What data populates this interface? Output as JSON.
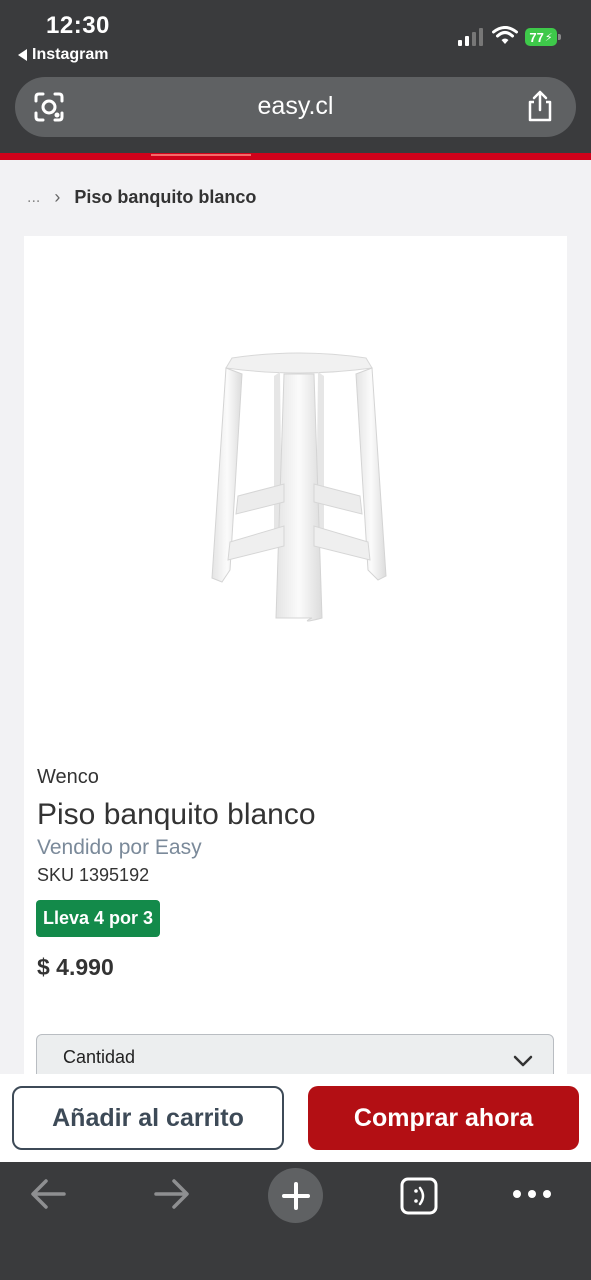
{
  "status_bar": {
    "time": "12:30",
    "back_app": "Instagram",
    "battery": "77"
  },
  "browser": {
    "url": "easy.cl"
  },
  "breadcrumb": {
    "ellipsis": "...",
    "current": "Piso banquito blanco"
  },
  "product": {
    "brand": "Wenco",
    "title": "Piso banquito blanco",
    "seller": "Vendido por Easy",
    "sku": "SKU 1395192",
    "promo_badge": "Lleva 4 por 3",
    "price": "$ 4.990",
    "quantity_label": "Cantidad"
  },
  "actions": {
    "add_to_cart": "Añadir al carrito",
    "buy_now": "Comprar ahora"
  },
  "colors": {
    "accent_red": "#d0021b",
    "buy_button": "#b30f14",
    "promo_green": "#138a4a",
    "browser_chrome": "#3a3b3d"
  },
  "icons": [
    "back-icon",
    "lens-icon",
    "share-icon",
    "chevron-right-icon",
    "chevron-down-icon",
    "arrow-left-icon",
    "arrow-right-icon",
    "plus-icon",
    "tabs-icon",
    "more-icon"
  ]
}
